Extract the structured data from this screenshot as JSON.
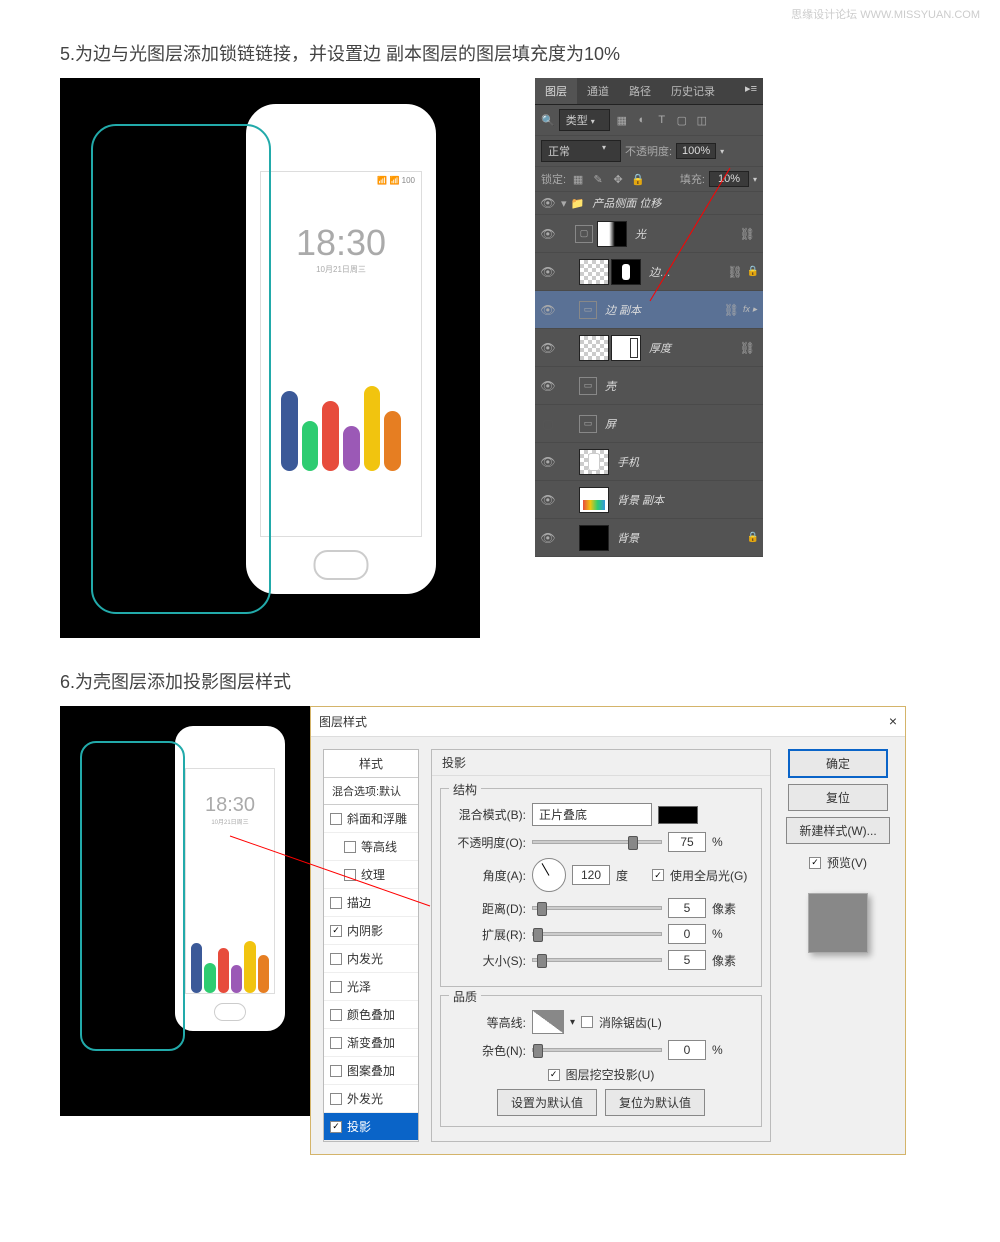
{
  "watermark": {
    "main": "思缘设计论坛",
    "url": "WWW.MISSYUAN.COM"
  },
  "step5": {
    "text": "5.为边与光图层添加锁链链接，并设置边 副本图层的图层填充度为10%"
  },
  "step6": {
    "text": "6.为壳图层添加投影图层样式"
  },
  "layers_panel": {
    "tabs": {
      "layers": "图层",
      "channels": "通道",
      "paths": "路径",
      "history": "历史记录"
    },
    "filter_label": "类型",
    "blend_mode": "正常",
    "opacity_label": "不透明度:",
    "opacity_value": "100%",
    "lock_label": "锁定:",
    "fill_label": "填充:",
    "fill_value": "10%",
    "group_name": "产品侧面 位移",
    "layers": [
      {
        "name": "光",
        "linked": true
      },
      {
        "name": "边…",
        "linked": true,
        "locked": true
      },
      {
        "name": "边 副本",
        "linked": true,
        "fx": true,
        "selected": true
      },
      {
        "name": "厚度",
        "linked": true
      },
      {
        "name": "壳",
        "smart": true
      },
      {
        "name": "屏",
        "smart": true,
        "hidden": true
      },
      {
        "name": "手机"
      },
      {
        "name": "背景 副本"
      },
      {
        "name": "背景",
        "locked": true
      }
    ]
  },
  "layer_style": {
    "title": "图层样式",
    "left": {
      "header": "样式",
      "blend_options": "混合选项:默认",
      "items": [
        {
          "label": "斜面和浮雕",
          "checked": false
        },
        {
          "label": "等高线",
          "checked": false,
          "indent": true
        },
        {
          "label": "纹理",
          "checked": false,
          "indent": true
        },
        {
          "label": "描边",
          "checked": false
        },
        {
          "label": "内阴影",
          "checked": true
        },
        {
          "label": "内发光",
          "checked": false
        },
        {
          "label": "光泽",
          "checked": false
        },
        {
          "label": "颜色叠加",
          "checked": false
        },
        {
          "label": "渐变叠加",
          "checked": false
        },
        {
          "label": "图案叠加",
          "checked": false
        },
        {
          "label": "外发光",
          "checked": false
        },
        {
          "label": "投影",
          "checked": true,
          "selected": true
        }
      ]
    },
    "center": {
      "title": "投影",
      "structure_label": "结构",
      "blend_mode_label": "混合模式(B):",
      "blend_mode_value": "正片叠底",
      "opacity_label": "不透明度(O):",
      "opacity_value": "75",
      "opacity_unit": "%",
      "angle_label": "角度(A):",
      "angle_value": "120",
      "angle_unit": "度",
      "global_light": "使用全局光(G)",
      "distance_label": "距离(D):",
      "distance_value": "5",
      "distance_unit": "像素",
      "spread_label": "扩展(R):",
      "spread_value": "0",
      "spread_unit": "%",
      "size_label": "大小(S):",
      "size_value": "5",
      "size_unit": "像素",
      "quality_label": "品质",
      "contour_label": "等高线:",
      "antialias_label": "消除锯齿(L)",
      "noise_label": "杂色(N):",
      "noise_value": "0",
      "noise_unit": "%",
      "knockout_label": "图层挖空投影(U)",
      "set_default": "设置为默认值",
      "reset_default": "复位为默认值"
    },
    "right": {
      "ok": "确定",
      "cancel": "复位",
      "new_style": "新建样式(W)...",
      "preview": "预览(V)"
    }
  }
}
